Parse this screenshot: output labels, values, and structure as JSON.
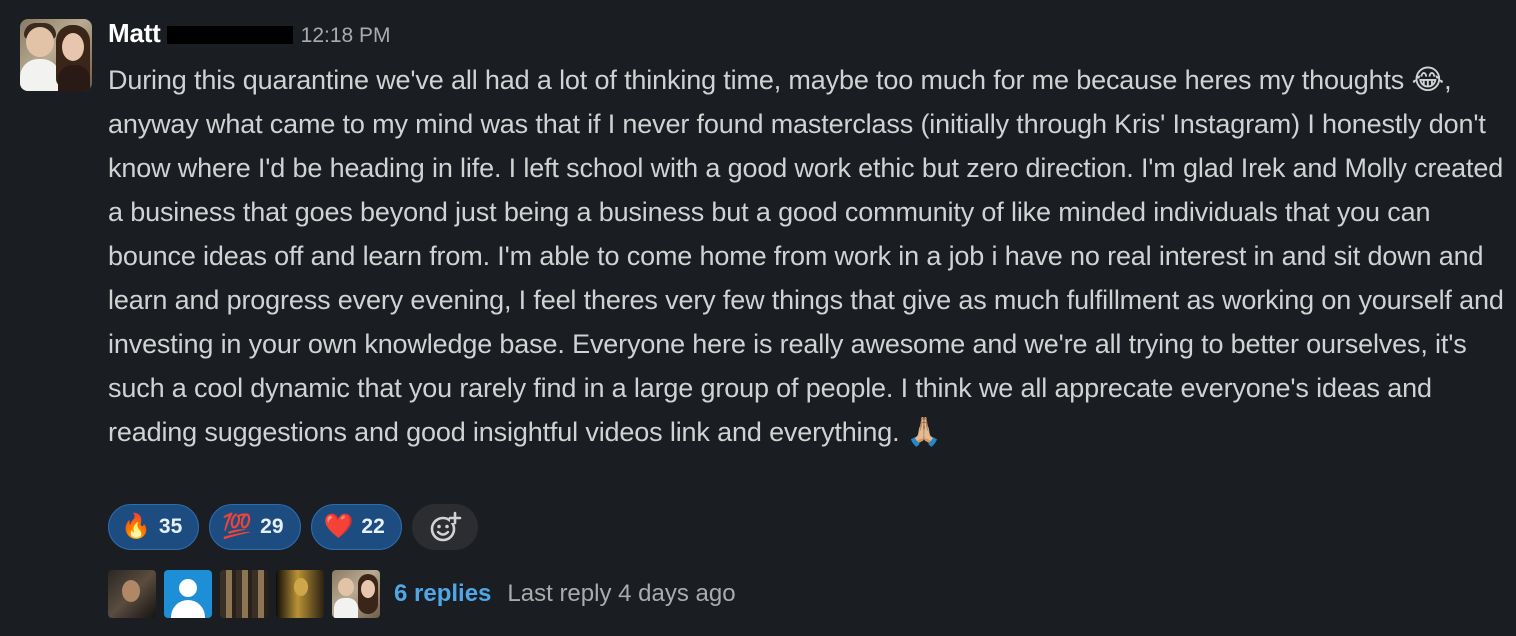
{
  "message": {
    "author_first": "Matt",
    "timestamp": "12:18 PM",
    "text_parts": [
      "During this quarantine we've all had a lot of thinking time, maybe too much for me because heres my thoughts ",
      ", anyway what came to my mind was that if I never found masterclass (initially through Kris' Instagram) I honestly don't know where I'd be heading in life. I left school with a good work ethic but zero direction. I'm glad Irek and Molly created a business that goes beyond just being a business but a good community of like minded individuals that you can bounce ideas off and learn from. I'm able to come home from work in a job i have no real interest in and sit down and learn and progress every evening, I feel theres very few things that give as much fulfillment as working on yourself and investing in your own knowledge base. Everyone here is really awesome and we're all trying to better ourselves, it's such a cool dynamic that you rarely find in a large group of people. I think we all apprecate everyone's ideas and reading suggestions and good insightful videos link and everything. "
    ],
    "inline_emoji": [
      "😂",
      "🙏🏼"
    ]
  },
  "reactions": [
    {
      "emoji": "🔥",
      "count": "35"
    },
    {
      "emoji": "💯",
      "count": "29"
    },
    {
      "emoji": "❤️",
      "count": "22"
    }
  ],
  "add_reaction_icon": "add-emoji-reaction-icon",
  "thread": {
    "replies_label": "6 replies",
    "last_reply": "Last reply 4 days ago",
    "participant_count": 5
  },
  "colors": {
    "background": "#1a1d21",
    "reaction_bg": "#1d4d80",
    "link": "#4fa7e8"
  }
}
